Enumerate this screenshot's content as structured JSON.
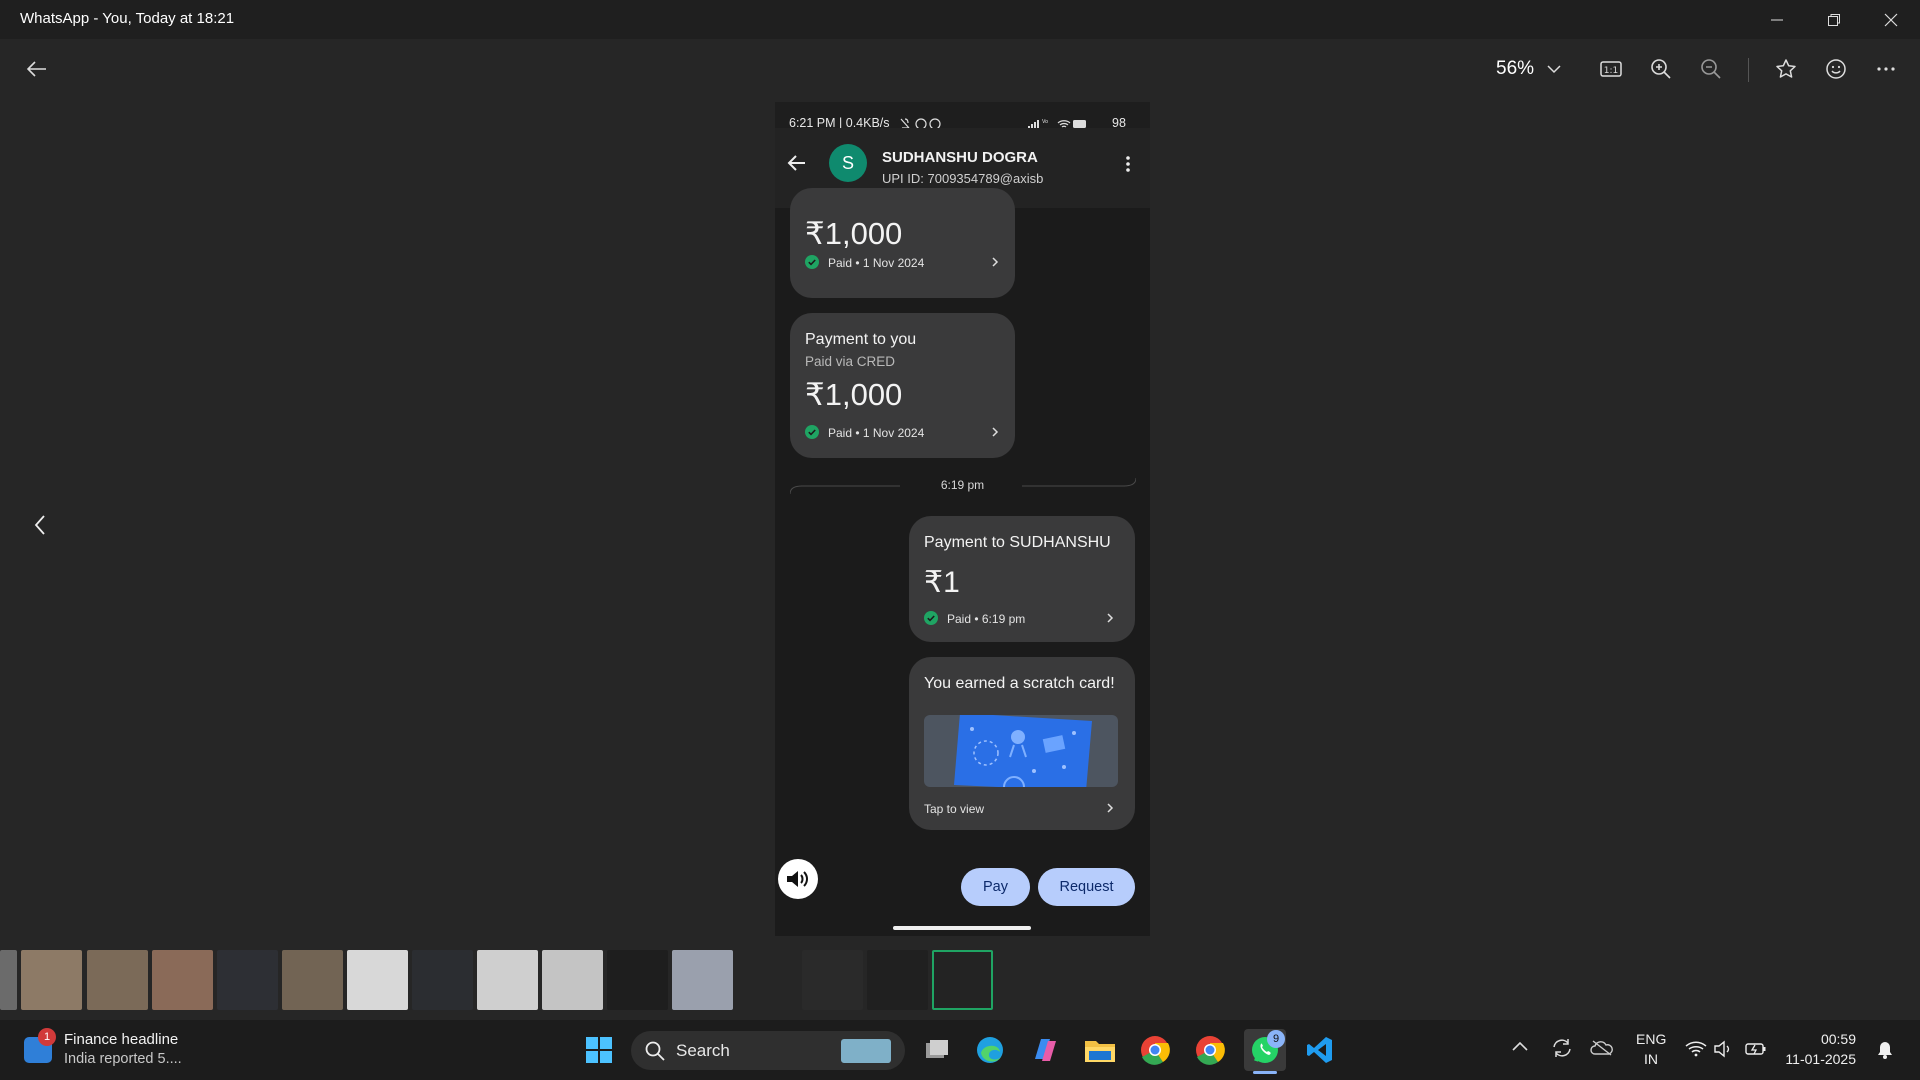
{
  "window": {
    "title": "WhatsApp - You, Today at 18:21"
  },
  "viewer": {
    "zoom": "56%"
  },
  "phone": {
    "status": {
      "left": "6:21 PM | 0.4KB/s",
      "battery": "98"
    },
    "contact": {
      "initial": "S",
      "name": "SUDHANSHU DOGRA",
      "upi": "UPI ID: 7009354789@axisb"
    },
    "messages": [
      {
        "amount": "₹1,000",
        "status": "Paid • 1 Nov 2024"
      },
      {
        "title": "Payment to you",
        "subtitle": "Paid via CRED",
        "amount": "₹1,000",
        "status": "Paid • 1 Nov 2024"
      }
    ],
    "divider_time": "6:19 pm",
    "sent": {
      "title": "Payment to SUDHANSHU",
      "amount": "₹1",
      "status": "Paid • 6:19 pm"
    },
    "scratch": {
      "title": "You earned a scratch card!",
      "cta": "Tap to view"
    },
    "actions": {
      "pay": "Pay",
      "request": "Request"
    }
  },
  "taskbar": {
    "news": {
      "badge": "1",
      "title": "Finance headline",
      "subtitle": "India reported 5...."
    },
    "search_placeholder": "Search",
    "whatsapp_badge": "9",
    "lang": {
      "line1": "ENG",
      "line2": "IN"
    },
    "clock": {
      "time": "00:59",
      "date": "11-01-2025"
    }
  },
  "colors": {
    "accent_green": "#1fa463",
    "avatar": "#0f8a6e",
    "pill": "#b7cdfc",
    "scratch_blue": "#2a6fe6"
  }
}
